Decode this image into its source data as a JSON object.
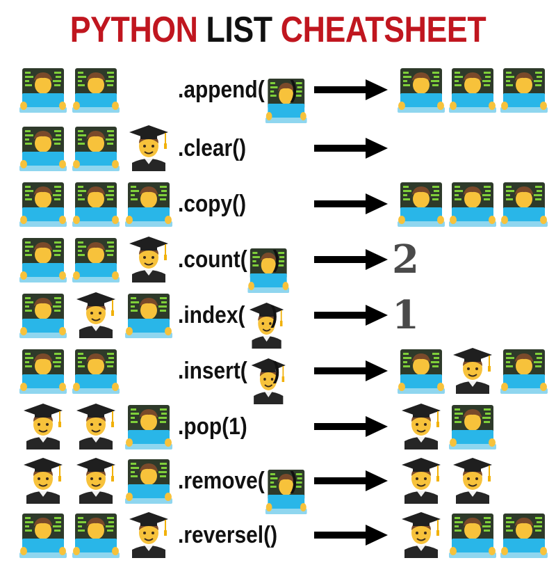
{
  "title": {
    "part1": "PYTHON",
    "part2": "LIST",
    "part3": "CHEATSHEET"
  },
  "rows": [
    {
      "input": [
        "technologist",
        "technologist"
      ],
      "method_prefix": ".append(",
      "arg": "technologist",
      "method_suffix": ")",
      "result": [
        "technologist",
        "technologist",
        "technologist"
      ],
      "result_text": ""
    },
    {
      "input": [
        "technologist",
        "technologist",
        "student"
      ],
      "method_prefix": ".clear()",
      "arg": "",
      "method_suffix": "",
      "result": [],
      "result_text": ""
    },
    {
      "input": [
        "technologist",
        "technologist",
        "technologist"
      ],
      "method_prefix": ".copy()",
      "arg": "",
      "method_suffix": "",
      "result": [
        "technologist",
        "technologist",
        "technologist"
      ],
      "result_text": ""
    },
    {
      "input": [
        "technologist",
        "technologist",
        "student"
      ],
      "method_prefix": ".count(",
      "arg": "technologist",
      "method_suffix": ")",
      "result": [],
      "result_text": "2"
    },
    {
      "input": [
        "technologist",
        "student",
        "technologist"
      ],
      "method_prefix": ".index(",
      "arg": "student",
      "method_suffix": ")",
      "result": [],
      "result_text": "1"
    },
    {
      "input": [
        "technologist",
        "technologist"
      ],
      "method_prefix": ".insert(",
      "arg": "student",
      "method_suffix": ")",
      "result": [
        "technologist",
        "student",
        "technologist"
      ],
      "result_text": ""
    },
    {
      "input": [
        "student",
        "student",
        "technologist"
      ],
      "method_prefix": ".pop(1)",
      "arg": "",
      "method_suffix": "",
      "result": [
        "student",
        "technologist"
      ],
      "result_text": ""
    },
    {
      "input": [
        "student",
        "student",
        "technologist"
      ],
      "method_prefix": ".remove(",
      "arg": "technologist",
      "method_suffix": ")",
      "result": [
        "student",
        "student"
      ],
      "result_text": ""
    },
    {
      "input": [
        "technologist",
        "technologist",
        "student"
      ],
      "method_prefix": ".reversel()",
      "arg": "",
      "method_suffix": "",
      "result": [
        "student",
        "technologist",
        "technologist"
      ],
      "result_text": ""
    }
  ],
  "colors": {
    "title_red": "#c0161f",
    "title_black": "#111111",
    "laptop": "#29b6e8",
    "code_green": "#7fd03a",
    "skin": "#f7c23b",
    "hair": "#7a4a2a",
    "cap": "#1f1f1f"
  }
}
